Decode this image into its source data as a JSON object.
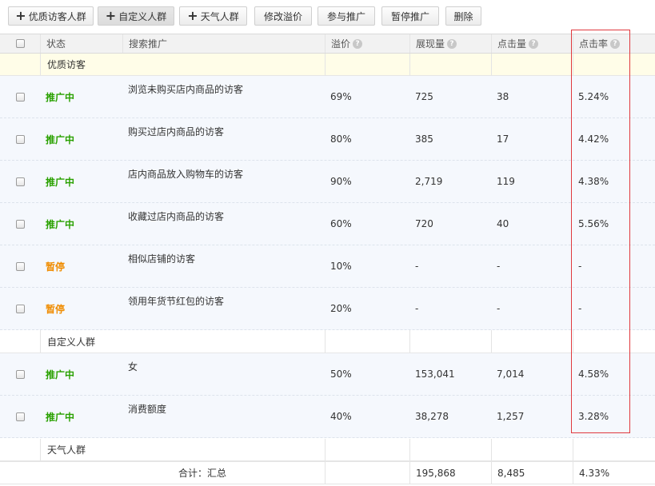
{
  "toolbar": {
    "add_quality_label": "优质访客人群",
    "add_custom_label": "自定义人群",
    "add_weather_label": "天气人群",
    "edit_premium_label": "修改溢价",
    "join_label": "参与推广",
    "pause_label": "暂停推广",
    "delete_label": "删除"
  },
  "header": {
    "status": "状态",
    "search": "搜索推广",
    "premium": "溢价",
    "impressions": "展现量",
    "clicks": "点击量",
    "ctr": "点击率"
  },
  "groups": {
    "quality": "优质访客",
    "custom": "自定义人群",
    "weather": "天气人群"
  },
  "rows": [
    {
      "status": "推广中",
      "name": "浏览未购买店内商品的访客",
      "premium": "69%",
      "impressions": "725",
      "clicks": "38",
      "ctr": "5.24%"
    },
    {
      "status": "推广中",
      "name": "购买过店内商品的访客",
      "premium": "80%",
      "impressions": "385",
      "clicks": "17",
      "ctr": "4.42%"
    },
    {
      "status": "推广中",
      "name": "店内商品放入购物车的访客",
      "premium": "90%",
      "impressions": "2,719",
      "clicks": "119",
      "ctr": "4.38%"
    },
    {
      "status": "推广中",
      "name": "收藏过店内商品的访客",
      "premium": "60%",
      "impressions": "720",
      "clicks": "40",
      "ctr": "5.56%"
    },
    {
      "status": "暂停",
      "name": "相似店铺的访客",
      "premium": "10%",
      "impressions": "-",
      "clicks": "-",
      "ctr": "-"
    },
    {
      "status": "暂停",
      "name": "领用年货节红包的访客",
      "premium": "20%",
      "impressions": "-",
      "clicks": "-",
      "ctr": "-"
    },
    {
      "status": "推广中",
      "name": "女",
      "premium": "50%",
      "impressions": "153,041",
      "clicks": "7,014",
      "ctr": "4.58%"
    },
    {
      "status": "推广中",
      "name": "消费额度",
      "premium": "40%",
      "impressions": "38,278",
      "clicks": "1,257",
      "ctr": "3.28%"
    }
  ],
  "total": {
    "label": "合计：汇总",
    "impressions": "195,868",
    "clicks": "8,485",
    "ctr": "4.33%"
  },
  "help_glyph": "?",
  "plus_glyph": "+",
  "colors": {
    "active_status": "#2aa100",
    "paused_status": "#f08c00",
    "highlight_border": "#e0393e",
    "group_background": "#fffde8",
    "row_background": "#f5f8fd"
  }
}
